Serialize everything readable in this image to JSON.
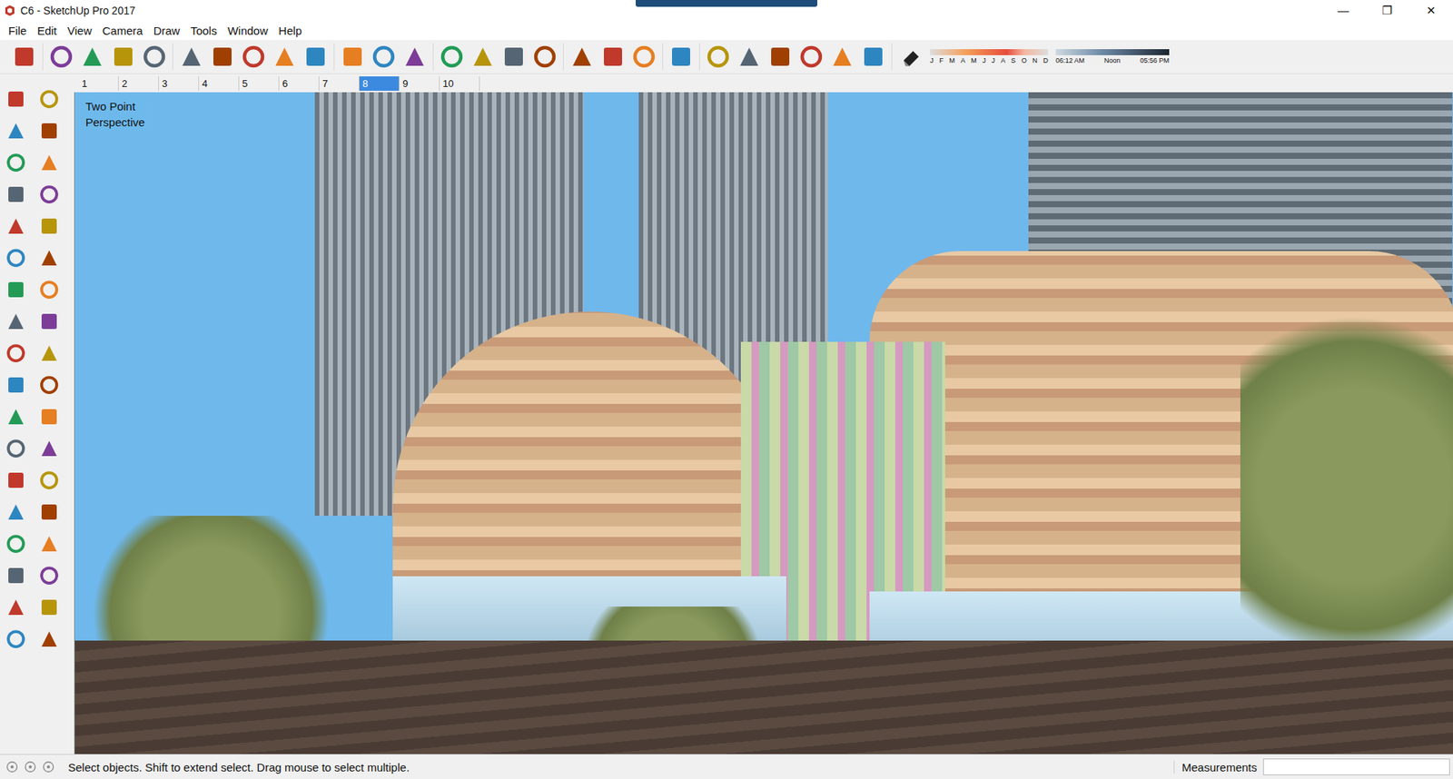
{
  "window": {
    "title": "C6 - SketchUp Pro 2017",
    "controls": [
      "—",
      "❐",
      "✕"
    ]
  },
  "menu": [
    "File",
    "Edit",
    "View",
    "Camera",
    "Draw",
    "Tools",
    "Window",
    "Help"
  ],
  "scenes": [
    {
      "label": "1",
      "selected": false
    },
    {
      "label": "2",
      "selected": false
    },
    {
      "label": "3",
      "selected": false
    },
    {
      "label": "4",
      "selected": false
    },
    {
      "label": "5",
      "selected": false
    },
    {
      "label": "6",
      "selected": false
    },
    {
      "label": "7",
      "selected": false
    },
    {
      "label": "8",
      "selected": true
    },
    {
      "label": "9",
      "selected": false
    },
    {
      "label": "10",
      "selected": false
    }
  ],
  "shadows": {
    "months": [
      "J",
      "F",
      "M",
      "A",
      "M",
      "J",
      "J",
      "A",
      "S",
      "O",
      "N",
      "D"
    ],
    "times": [
      "06:12 AM",
      "Noon",
      "05:56 PM"
    ]
  },
  "viewport": {
    "camera_label": [
      "Two Point",
      "Perspective"
    ]
  },
  "status_bar": {
    "message": "Select objects. Shift to extend select. Drag mouse to select multiple.",
    "measurements_label": "Measurements",
    "measurements_value": ""
  }
}
